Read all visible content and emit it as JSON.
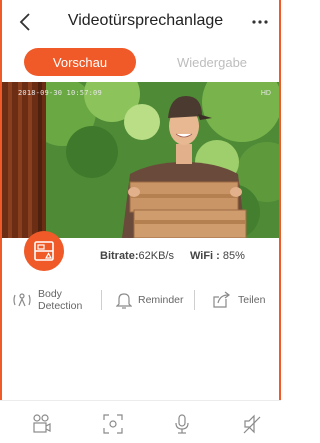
{
  "header": {
    "title": "Videotürsprechanlage"
  },
  "tabs": [
    {
      "label": "Vorschau",
      "active": true
    },
    {
      "label": "Wiedergabe",
      "active": false
    }
  ],
  "video": {
    "timestamp": "2018-09-30 10:57:09",
    "watermark": "HD"
  },
  "stats": {
    "bitrate_label": "Bitrate:",
    "bitrate_value": "62KB/s",
    "wifi_label": "WiFi :",
    "wifi_value": "85%"
  },
  "features": {
    "body_detection_line1": "Body",
    "body_detection_line2": "Detection",
    "reminder": "Reminder",
    "share": "Teilen"
  },
  "colors": {
    "accent": "#f05a28",
    "inactive_text": "#bdbdbd",
    "icon_gray": "#8a8a8a"
  },
  "icons": {
    "back": "chevron-left-icon",
    "more": "more-horizontal-icon",
    "snapshot": "doorbell-panel-icon",
    "body_detection": "motion-detection-icon",
    "reminder": "bell-icon",
    "share": "share-icon",
    "multiview": "multi-camera-icon",
    "screenshot": "capture-icon",
    "microphone": "microphone-icon",
    "mute": "speaker-mute-icon"
  }
}
